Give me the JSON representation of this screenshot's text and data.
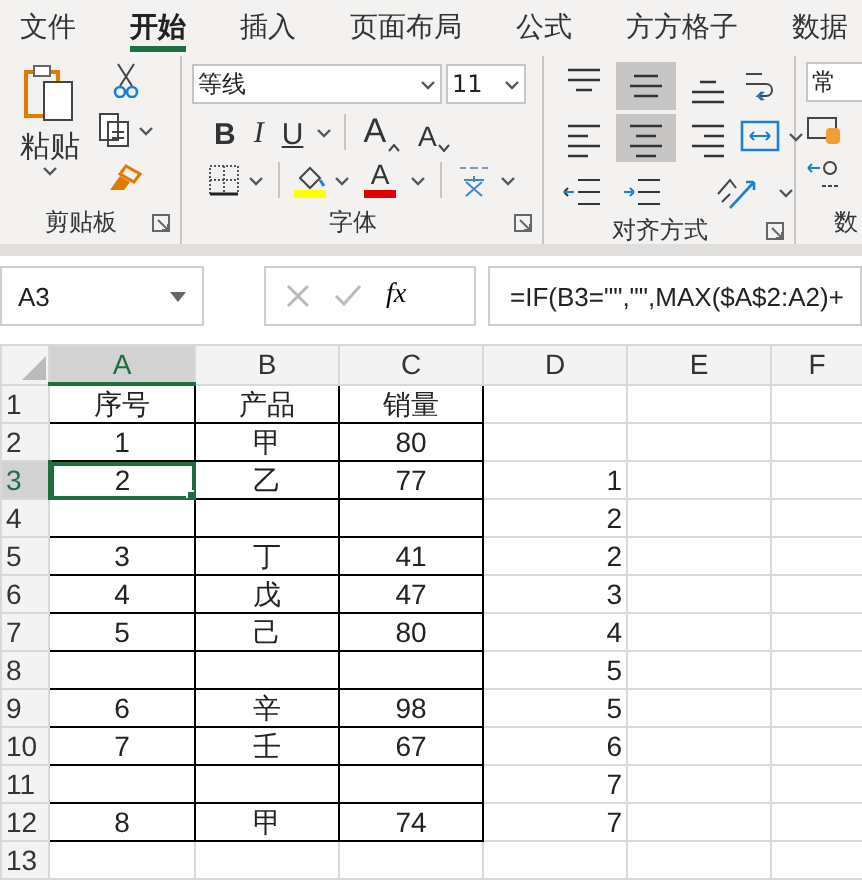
{
  "tabs": [
    {
      "label": "文件",
      "selected": false
    },
    {
      "label": "开始",
      "selected": true
    },
    {
      "label": "插入",
      "selected": false
    },
    {
      "label": "页面布局",
      "selected": false
    },
    {
      "label": "公式",
      "selected": false
    },
    {
      "label": "方方格子",
      "selected": false
    },
    {
      "label": "数据",
      "selected": false
    }
  ],
  "ribbon": {
    "clipboard": {
      "paste_label": "粘贴",
      "group_label": "剪贴板"
    },
    "font": {
      "font_name": "等线",
      "font_size": "11",
      "bold": "B",
      "italic": "I",
      "underline": "U",
      "grow": "A",
      "shrink": "A",
      "font_color": "A",
      "group_label": "字体"
    },
    "alignment": {
      "group_label": "对齐方式",
      "buttons": [
        {
          "kind": "top",
          "selected": false
        },
        {
          "kind": "middle",
          "selected": true
        },
        {
          "kind": "bottom",
          "selected": false
        },
        {
          "kind": "left",
          "selected": false
        },
        {
          "kind": "center",
          "selected": true
        },
        {
          "kind": "right",
          "selected": false
        }
      ]
    },
    "number": {
      "format": "常",
      "group_label": "数"
    }
  },
  "formula_bar": {
    "name_box": "A3",
    "fx": "fx",
    "formula": "=IF(B3=\"\",\"\",MAX($A$2:A2)+"
  },
  "sheet": {
    "columns": [
      {
        "label": "A",
        "selected": true,
        "bordered": true
      },
      {
        "label": "B",
        "selected": false,
        "bordered": true
      },
      {
        "label": "C",
        "selected": false,
        "bordered": true
      },
      {
        "label": "D",
        "selected": false,
        "bordered": false
      },
      {
        "label": "E",
        "selected": false,
        "bordered": false
      },
      {
        "label": "F",
        "selected": false,
        "bordered": false
      }
    ],
    "rows": [
      {
        "label": "1",
        "selected": false,
        "bordered": true,
        "cells": [
          "序号",
          "产品",
          "销量",
          null
        ]
      },
      {
        "label": "2",
        "selected": false,
        "bordered": true,
        "cells": [
          "1",
          "甲",
          "80",
          null
        ]
      },
      {
        "label": "3",
        "selected": true,
        "bordered": true,
        "cells": [
          "2",
          "乙",
          "77",
          "1"
        ]
      },
      {
        "label": "4",
        "selected": false,
        "bordered": true,
        "cells": [
          null,
          null,
          null,
          "2"
        ]
      },
      {
        "label": "5",
        "selected": false,
        "bordered": true,
        "cells": [
          "3",
          "丁",
          "41",
          "2"
        ]
      },
      {
        "label": "6",
        "selected": false,
        "bordered": true,
        "cells": [
          "4",
          "戊",
          "47",
          "3"
        ]
      },
      {
        "label": "7",
        "selected": false,
        "bordered": true,
        "cells": [
          "5",
          "己",
          "80",
          "4"
        ]
      },
      {
        "label": "8",
        "selected": false,
        "bordered": true,
        "cells": [
          null,
          null,
          null,
          "5"
        ]
      },
      {
        "label": "9",
        "selected": false,
        "bordered": true,
        "cells": [
          "6",
          "辛",
          "98",
          "5"
        ]
      },
      {
        "label": "10",
        "selected": false,
        "bordered": true,
        "cells": [
          "7",
          "壬",
          "67",
          "6"
        ]
      },
      {
        "label": "11",
        "selected": false,
        "bordered": true,
        "cells": [
          null,
          null,
          null,
          "7"
        ]
      },
      {
        "label": "12",
        "selected": false,
        "bordered": true,
        "cells": [
          "8",
          "甲",
          "74",
          "7"
        ]
      },
      {
        "label": "13",
        "selected": false,
        "bordered": false,
        "cells": []
      }
    ]
  }
}
